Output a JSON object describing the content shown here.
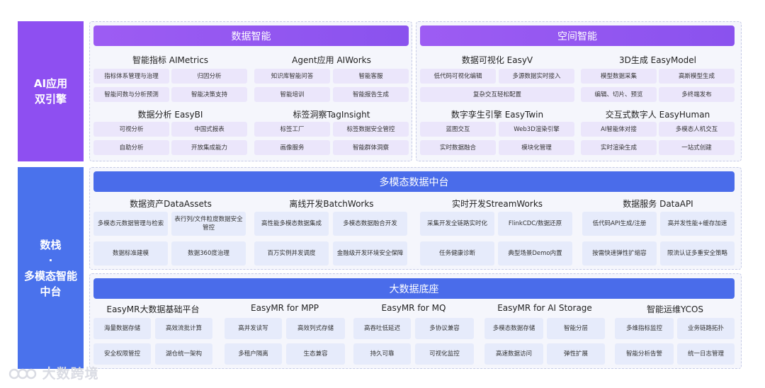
{
  "side": {
    "ai": [
      "AI应用",
      "双引擎"
    ],
    "ds": [
      "数栈",
      "·",
      "多模态智能",
      "中台"
    ]
  },
  "top": {
    "left": {
      "header": "数据智能",
      "groups": [
        {
          "title": "智能指标 AIMetrics",
          "items": [
            "指标体系管理与治理",
            "归因分析",
            "智能问数与分析预测",
            "智能决策支持"
          ]
        },
        {
          "title": "Agent应用 AIWorks",
          "items": [
            "知识库智能问答",
            "智能客服",
            "智能培训",
            "智能报告生成"
          ]
        },
        {
          "title": "数据分析 EasyBI",
          "items": [
            "可视分析",
            "中国式报表",
            "自助分析",
            "开放集成能力"
          ]
        },
        {
          "title": "标签洞察TagInsight",
          "items": [
            "标签工厂",
            "标签数据安全管控",
            "画像服务",
            "智能群体洞察"
          ]
        }
      ]
    },
    "right": {
      "header": "空间智能",
      "groups": [
        {
          "title": "数据可视化 EasyV",
          "items": [
            "低代码可视化编辑",
            "多源数据实时接入",
            "复杂交互轻松配置"
          ]
        },
        {
          "title": "3D生成 EasyModel",
          "items": [
            "模型数据采集",
            "高斯模型生成",
            "编辑、切片、预览",
            "多终端发布"
          ]
        },
        {
          "title": "数字孪生引擎 EasyTwin",
          "items": [
            "蓝图交互",
            "Web3D渲染引擎",
            "实时数据融合",
            "模块化管理"
          ]
        },
        {
          "title": "交互式数字人 EasyHuman",
          "items": [
            "AI智能体对接",
            "多模态人机交互",
            "实时渲染生成",
            "一站式创建"
          ]
        }
      ]
    }
  },
  "mid": {
    "header": "多模态数据中台",
    "groups": [
      {
        "title": "数据资产DataAssets",
        "items": [
          "多模态元数据管理与检索",
          "表行列/文件粒度数据安全管控",
          "数据标准建模",
          "数据360度治理"
        ]
      },
      {
        "title": "离线开发BatchWorks",
        "items": [
          "高性能多模态数据集成",
          "多模态数据融合开发",
          "百万实例并发调度",
          "金融级开发环境安全保障"
        ]
      },
      {
        "title": "实时开发StreamWorks",
        "items": [
          "采集开发全链路实时化",
          "FlinkCDC/数据还原",
          "任务健康诊断",
          "典型场景Demo内置"
        ]
      },
      {
        "title": "数据服务 DataAPI",
        "items": [
          "低代码API生成/注册",
          "高并发性能+缓存加速",
          "按需快速弹性扩缩容",
          "限流认证多重安全策略"
        ]
      }
    ]
  },
  "bottom": {
    "header": "大数据底座",
    "groups": [
      {
        "title": "EasyMR大数据基础平台",
        "items": [
          "海量数据存储",
          "高效流批计算",
          "安全权限管控",
          "湖仓统一架构"
        ]
      },
      {
        "title": "EasyMR for MPP",
        "items": [
          "高并发读写",
          "高效列式存储",
          "多租户隔离",
          "生态兼容"
        ]
      },
      {
        "title": "EasyMR for MQ",
        "items": [
          "高吞吐低延迟",
          "多协议兼容",
          "持久可靠",
          "可视化监控"
        ]
      },
      {
        "title": "EasyMR for AI Storage",
        "items": [
          "多模态数据存储",
          "智能分层",
          "高速数据访问",
          "弹性扩展"
        ]
      },
      {
        "title": "智能运维YCOS",
        "items": [
          "多维指标监控",
          "业务链路拓扑",
          "智能分析告警",
          "统一日志管理"
        ]
      }
    ]
  },
  "watermark": "大数跨境"
}
